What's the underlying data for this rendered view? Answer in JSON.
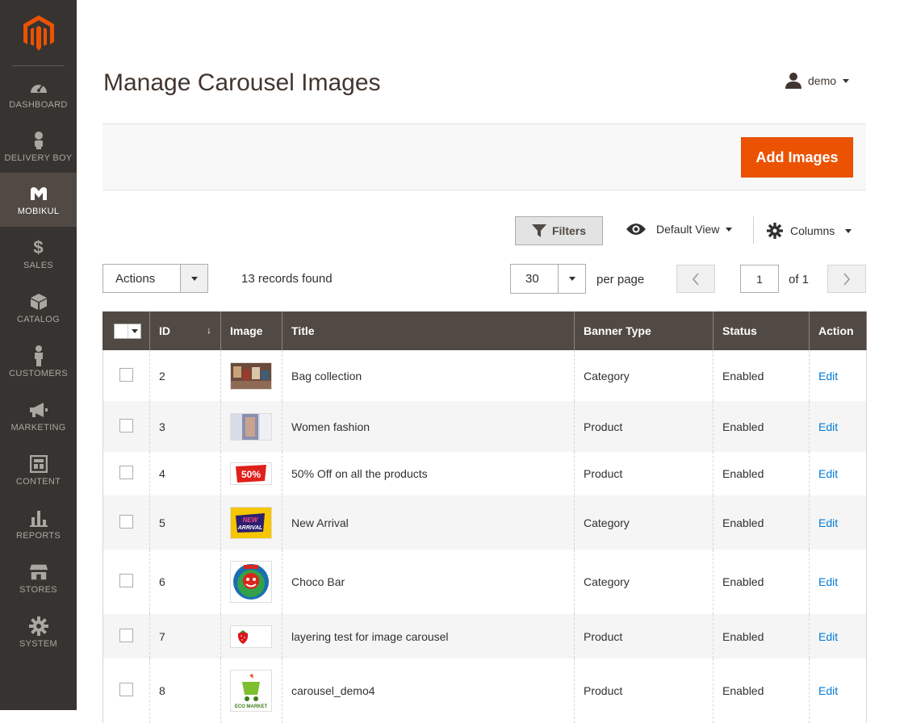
{
  "nav": [
    {
      "label": "DASHBOARD",
      "icon": "dashboard-icon"
    },
    {
      "label": "DELIVERY BOY",
      "icon": "delivery-boy-icon"
    },
    {
      "label": "MOBIKUL",
      "icon": "mobikul-icon"
    },
    {
      "label": "SALES",
      "icon": "dollar-icon"
    },
    {
      "label": "CATALOG",
      "icon": "box-icon"
    },
    {
      "label": "CUSTOMERS",
      "icon": "person-icon"
    },
    {
      "label": "MARKETING",
      "icon": "megaphone-icon"
    },
    {
      "label": "CONTENT",
      "icon": "layout-icon"
    },
    {
      "label": "REPORTS",
      "icon": "bar-chart-icon"
    },
    {
      "label": "STORES",
      "icon": "storefront-icon"
    },
    {
      "label": "SYSTEM",
      "icon": "gear-icon"
    }
  ],
  "header": {
    "title": "Manage Carousel Images",
    "user": "demo"
  },
  "toolbar": {
    "add_label": "Add Images"
  },
  "grid_controls": {
    "filters_label": "Filters",
    "view_label": "Default View",
    "columns_label": "Columns",
    "actions_label": "Actions",
    "records_text": "13 records found",
    "per_page_value": "30",
    "per_page_label": "per page",
    "page_value": "1",
    "page_total": "of 1"
  },
  "table": {
    "columns": [
      "ID",
      "Image",
      "Title",
      "Banner Type",
      "Status",
      "Action"
    ],
    "rows": [
      {
        "id": "2",
        "title": "Bag collection",
        "type": "Category",
        "status": "Enabled",
        "action": "Edit",
        "thumb": "photo-bags"
      },
      {
        "id": "3",
        "title": "Women fashion",
        "type": "Product",
        "status": "Enabled",
        "action": "Edit",
        "thumb": "photo-fashion"
      },
      {
        "id": "4",
        "title": "50% Off on all the products",
        "type": "Product",
        "status": "Enabled",
        "action": "Edit",
        "thumb": "sale-50"
      },
      {
        "id": "5",
        "title": "New Arrival",
        "type": "Category",
        "status": "Enabled",
        "action": "Edit",
        "thumb": "new-arrival"
      },
      {
        "id": "6",
        "title": "Choco Bar",
        "type": "Category",
        "status": "Enabled",
        "action": "Edit",
        "thumb": "choco-cheese"
      },
      {
        "id": "7",
        "title": "layering test for image carousel",
        "type": "Product",
        "status": "Enabled",
        "action": "Edit",
        "thumb": "strawberry"
      },
      {
        "id": "8",
        "title": "carousel_demo4",
        "type": "Product",
        "status": "Enabled",
        "action": "Edit",
        "thumb": "eco-market"
      }
    ]
  },
  "thumb_text": {
    "sale": "50%",
    "new1": "NEW",
    "new2": "ARRIVAL",
    "eco": "ECO MARKET"
  },
  "colors": {
    "accent": "#eb5202",
    "sidebar": "#373330",
    "header_row": "#514943",
    "link": "#007bdb"
  }
}
